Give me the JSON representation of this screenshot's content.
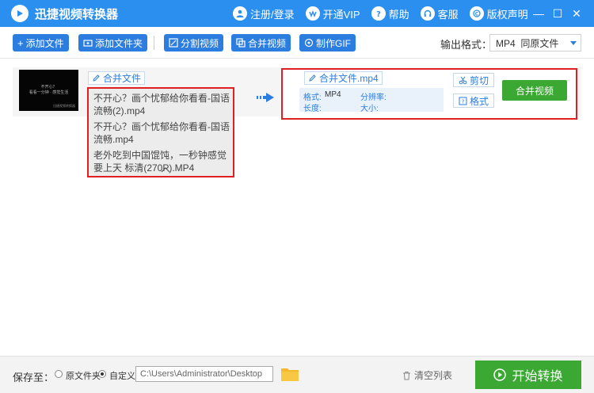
{
  "window": {
    "title": "迅捷视频转换器",
    "actions": [
      {
        "label": "注册/登录",
        "icon": "user-icon"
      },
      {
        "label": "开通VIP",
        "icon": "vip-icon"
      },
      {
        "label": "帮助",
        "icon": "question-icon"
      },
      {
        "label": "客服",
        "icon": "headset-icon"
      },
      {
        "label": "版权声明",
        "icon": "copyright-icon"
      }
    ],
    "controls": {
      "minimize": "—",
      "maximize": "☐",
      "close": "✕"
    }
  },
  "toolbar": {
    "add_file": "添加文件",
    "add_folder": "添加文件夹",
    "split_video": "分割视频",
    "merge_video": "合并视频",
    "make_gif": "制作GIF",
    "output_format_label": "输出格式：",
    "output_format_value": "MP4  同原文件"
  },
  "task": {
    "thumbnail_lines": [
      "不开心？",
      "看看一分钟 · 感觉生活"
    ],
    "thumbnail_mark": "迅捷视频转换器",
    "merge_tag": "合并文件",
    "files": [
      "不开心？画个忧郁给你看看-国语流畅(2).mp4",
      "不开心？画个忧郁给你看看-国语流畅.mp4",
      "老外吃到中国馄饨，一秒钟感觉要上天 标清(270P).MP4"
    ],
    "output_name": "合并文件.mp4",
    "info": {
      "format_label": "格式:",
      "format_value": "MP4",
      "resolution_label": "分辨率:",
      "duration_label": "长度:",
      "size_label": "大小:"
    },
    "cut_label": "剪切",
    "format_label": "格式",
    "merge_button": "合并视频"
  },
  "footer": {
    "save_to": "保存至：",
    "option_original": "原文件夹",
    "option_custom": "自定义",
    "path": "C:\\Users\\Administrator\\Desktop",
    "clear_list": "清空列表",
    "start": "开始转换"
  },
  "colors": {
    "primary": "#2b8ff0",
    "green": "#3aa832",
    "highlight": "#e02020"
  }
}
